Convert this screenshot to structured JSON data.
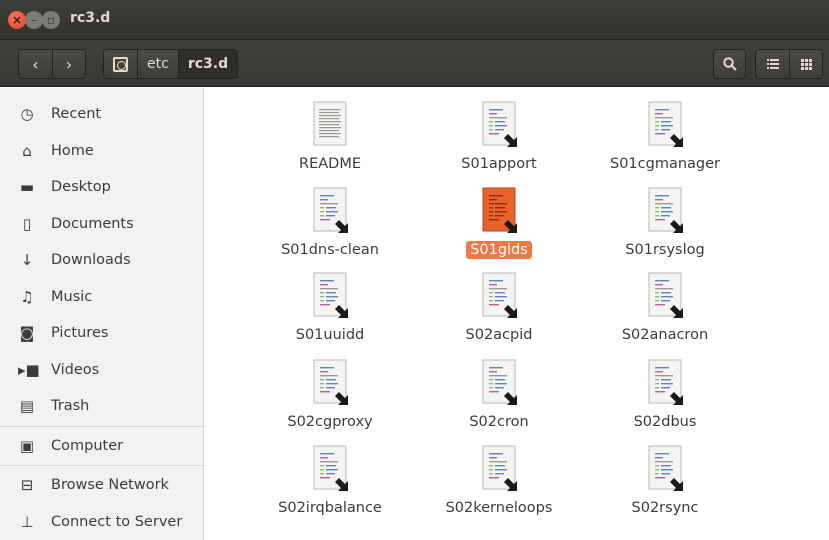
{
  "window": {
    "title": "rc3.d"
  },
  "titlebar_buttons": {
    "close": "×",
    "minimize": "–",
    "maximize": "▫"
  },
  "toolbar": {
    "back": "‹",
    "forward": "›",
    "breadcrumbs": [
      "etc",
      "rc3.d"
    ],
    "search_icon": "search-icon",
    "list_view_icon": "list-view-icon",
    "grid_view_icon": "grid-view-icon"
  },
  "sidebar": {
    "items": [
      {
        "label": "Recent",
        "icon": "clock-icon"
      },
      {
        "label": "Home",
        "icon": "home-icon"
      },
      {
        "label": "Desktop",
        "icon": "folder-icon"
      },
      {
        "label": "Documents",
        "icon": "document-icon"
      },
      {
        "label": "Downloads",
        "icon": "download-icon"
      },
      {
        "label": "Music",
        "icon": "music-icon"
      },
      {
        "label": "Pictures",
        "icon": "camera-icon"
      },
      {
        "label": "Videos",
        "icon": "video-icon"
      },
      {
        "label": "Trash",
        "icon": "trash-icon"
      },
      {
        "label": "Computer",
        "icon": "drive-icon"
      },
      {
        "label": "Browse Network",
        "icon": "network-icon"
      },
      {
        "label": "Connect to Server",
        "icon": "server-icon"
      }
    ]
  },
  "files": [
    {
      "name": "README",
      "type": "text"
    },
    {
      "name": "S01apport",
      "type": "link"
    },
    {
      "name": "S01cgmanager",
      "type": "link"
    },
    {
      "name": "S01dns-clean",
      "type": "link"
    },
    {
      "name": "S01glds",
      "type": "link",
      "selected": true
    },
    {
      "name": "S01rsyslog",
      "type": "link"
    },
    {
      "name": "S01uuidd",
      "type": "link"
    },
    {
      "name": "S02acpid",
      "type": "link"
    },
    {
      "name": "S02anacron",
      "type": "link"
    },
    {
      "name": "S02cgproxy",
      "type": "link"
    },
    {
      "name": "S02cron",
      "type": "link"
    },
    {
      "name": "S02dbus",
      "type": "link"
    },
    {
      "name": "S02irqbalance",
      "type": "link"
    },
    {
      "name": "S02kerneloops",
      "type": "link"
    },
    {
      "name": "S02rsync",
      "type": "link"
    }
  ]
}
